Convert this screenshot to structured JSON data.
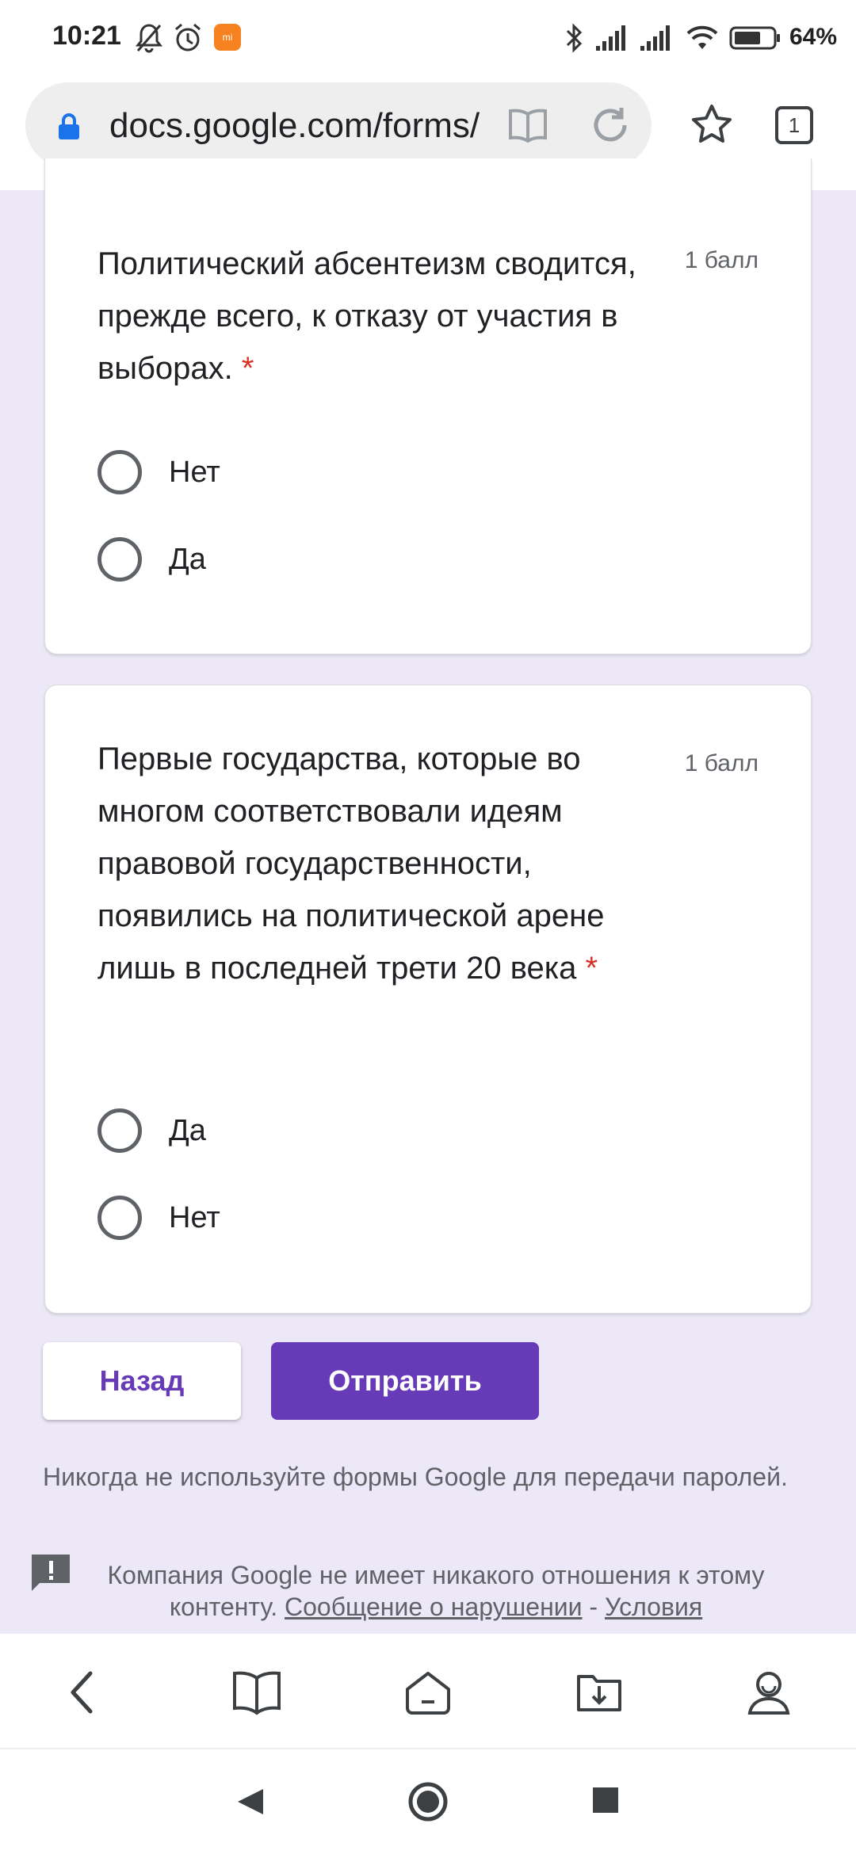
{
  "status_bar": {
    "time": "10:21",
    "battery": "64%",
    "icons": [
      "mute-bell-icon",
      "alarm-icon",
      "mi-app-icon",
      "bluetooth-icon",
      "signal-icon",
      "signal-icon",
      "wifi-icon",
      "battery-icon"
    ]
  },
  "browser": {
    "url": "docs.google.com/forms/",
    "tab_count": "1"
  },
  "questions": [
    {
      "text": "Политический абсентеизм сводится, прежде всего, к отказу от участия в выборах.",
      "required_mark": "*",
      "points": "1 балл",
      "options": [
        "Нет",
        "Да"
      ]
    },
    {
      "text": "Первые государства, которые во многом соответствовали идеям правовой государственности, появились на политической арене лишь в последней трети 20 века",
      "required_mark": "*",
      "points": "1 балл",
      "options": [
        "Да",
        "Нет"
      ]
    }
  ],
  "buttons": {
    "back": "Назад",
    "submit": "Отправить"
  },
  "footer": {
    "password_note": "Никогда не используйте формы Google для передачи паролей.",
    "disclaimer": "Компания Google не имеет никакого отношения к этому контенту.",
    "report_link": "Сообщение о нарушении",
    "separator": "-",
    "terms_link": "Условия"
  },
  "colors": {
    "accent": "#673ab7",
    "background": "#ece8f7",
    "required": "#d93025"
  }
}
